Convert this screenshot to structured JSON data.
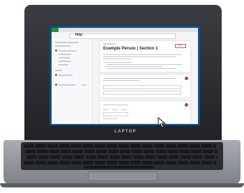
{
  "laptop": {
    "brand_label": "LAPTOP"
  },
  "browser": {
    "logo_text": "http:"
  },
  "form": {
    "section_heading": "Individual Form",
    "title": "Example Person | Section 1",
    "button_label": "Save"
  },
  "colors": {
    "screen_frame": "#0e4f86",
    "accent_green": "#2e8b3e",
    "required_red": "#c83a3a"
  },
  "icons": {
    "cursor": "mouse-pointer-icon"
  }
}
